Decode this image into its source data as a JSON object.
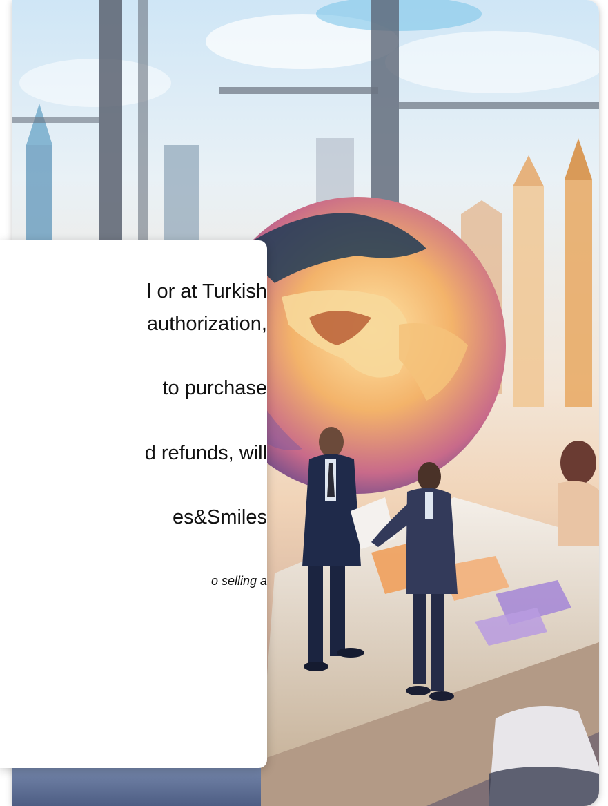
{
  "card": {
    "lines": [
      "l or at Turkish",
      "authorization,",
      "to purchase",
      "d refunds, will",
      "es&Smiles"
    ],
    "note": "o selling a"
  },
  "colors": {
    "sky": "#cfe6f6",
    "card_background": "#ffffff",
    "text": "#111111",
    "suit_dark": "#1f2a4a"
  },
  "icons": [
    "city-skyline-image",
    "globe-illustration",
    "business-people-illustration"
  ]
}
